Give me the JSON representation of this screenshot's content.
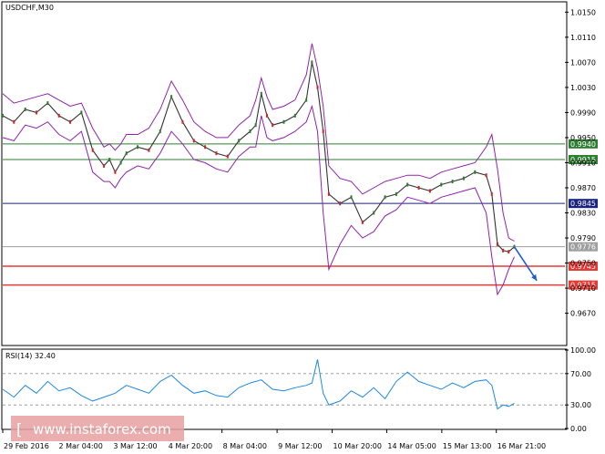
{
  "chart_data": [
    {
      "type": "line",
      "title": "USDCHF,M30",
      "indicator": "Bollinger Bands",
      "y_axis_side": "right",
      "ylim": [
        0.962,
        1.0165
      ],
      "x_range": [
        0,
        100
      ],
      "yticks": [
        "1.0150",
        "1.0110",
        "1.0070",
        "1.0030",
        "0.9990",
        "0.9950",
        "0.9910",
        "0.9870",
        "0.9830",
        "0.9790",
        "0.9750",
        "0.9710",
        "0.9670"
      ],
      "xticks": [
        {
          "x": 0,
          "label": "29 Feb 2016"
        },
        {
          "x": 9.8,
          "label": "2 Mar 04:00"
        },
        {
          "x": 19.5,
          "label": "3 Mar 12:00"
        },
        {
          "x": 29.3,
          "label": "4 Mar 20:00"
        },
        {
          "x": 39.0,
          "label": "8 Mar 04:00"
        },
        {
          "x": 48.8,
          "label": "9 Mar 12:00"
        },
        {
          "x": 58.6,
          "label": "10 Mar 20:00"
        },
        {
          "x": 68.3,
          "label": "14 Mar 05:00"
        },
        {
          "x": 78.1,
          "label": "15 Mar 13:00"
        },
        {
          "x": 87.8,
          "label": "16 Mar 21:00"
        }
      ],
      "levels": [
        {
          "value": 0.994,
          "label": "0.9940",
          "color": "#2e7d32",
          "label_bg": "#2e7d32"
        },
        {
          "value": 0.9915,
          "label": "0.9915",
          "color": "#2e7d32",
          "label_bg": "#2e7d32"
        },
        {
          "value": 0.9845,
          "label": "0.9845",
          "color": "#1a237e",
          "label_bg": "#1a237e"
        },
        {
          "value": 0.9776,
          "label": "0.9776",
          "color": "#9e9e9e",
          "label_bg": "#9e9e9e"
        },
        {
          "value": 0.9745,
          "label": "0.9745",
          "color": "#e53935",
          "label_bg": "#e53935"
        },
        {
          "value": 0.9715,
          "label": "0.9715",
          "color": "#e53935",
          "label_bg": "#e53935"
        }
      ],
      "price": {
        "x": [
          0,
          2,
          4,
          6,
          8,
          10,
          12,
          14,
          16,
          18,
          19,
          20,
          21,
          22,
          24,
          26,
          28,
          30,
          32,
          34,
          36,
          38,
          40,
          42,
          44,
          45,
          46,
          47,
          48,
          50,
          52,
          54,
          55,
          56,
          57,
          58,
          60,
          62,
          64,
          66,
          68,
          70,
          72,
          74,
          76,
          78,
          80,
          82,
          84,
          86,
          87,
          88,
          89,
          90,
          91
        ],
        "y": [
          0.9985,
          0.9975,
          0.9995,
          0.999,
          1.0005,
          0.9985,
          0.9975,
          0.999,
          0.993,
          0.9905,
          0.9915,
          0.9895,
          0.991,
          0.9925,
          0.9935,
          0.993,
          0.996,
          1.0015,
          0.9975,
          0.9945,
          0.9935,
          0.9925,
          0.992,
          0.9945,
          0.996,
          0.997,
          1.002,
          0.9985,
          0.997,
          0.9975,
          0.9985,
          1.001,
          1.007,
          1.003,
          0.996,
          0.986,
          0.9845,
          0.9855,
          0.9815,
          0.983,
          0.9855,
          0.986,
          0.9875,
          0.987,
          0.9865,
          0.9875,
          0.988,
          0.9885,
          0.9895,
          0.989,
          0.986,
          0.978,
          0.977,
          0.9768,
          0.9776
        ],
        "upper": [
          1.002,
          1.0005,
          1.001,
          1.0015,
          1.002,
          1.001,
          1.0,
          1.0005,
          0.9965,
          0.9935,
          0.994,
          0.993,
          0.994,
          0.9955,
          0.9955,
          0.9965,
          0.9995,
          1.004,
          1.001,
          0.9975,
          0.996,
          0.995,
          0.995,
          0.997,
          0.9985,
          1.001,
          1.0045,
          1.0015,
          0.9995,
          1.0,
          1.001,
          1.005,
          1.01,
          1.006,
          1.0,
          0.9905,
          0.9885,
          0.988,
          0.986,
          0.987,
          0.988,
          0.9885,
          0.989,
          0.989,
          0.9885,
          0.9895,
          0.99,
          0.9905,
          0.991,
          0.9935,
          0.9955,
          0.99,
          0.983,
          0.979,
          0.9785
        ],
        "lower": [
          0.995,
          0.9945,
          0.997,
          0.9965,
          0.9975,
          0.9955,
          0.9945,
          0.996,
          0.9895,
          0.988,
          0.988,
          0.987,
          0.9885,
          0.9895,
          0.9905,
          0.99,
          0.9925,
          0.996,
          0.994,
          0.9915,
          0.991,
          0.99,
          0.9895,
          0.992,
          0.9935,
          0.9935,
          0.9985,
          0.995,
          0.9945,
          0.995,
          0.996,
          0.9975,
          1.0,
          0.996,
          0.983,
          0.974,
          0.978,
          0.981,
          0.979,
          0.98,
          0.9825,
          0.9835,
          0.9855,
          0.985,
          0.9845,
          0.9855,
          0.986,
          0.9865,
          0.987,
          0.983,
          0.976,
          0.97,
          0.9715,
          0.974,
          0.976
        ]
      },
      "forecast_arrow": {
        "from": {
          "x": 91,
          "y": 0.9776
        },
        "to": {
          "x": 95,
          "y": 0.9722
        },
        "color": "#1e5bd6"
      }
    },
    {
      "type": "line",
      "title": "RSI(14) 32.40",
      "ylim": [
        0,
        100
      ],
      "yticks": [
        "100.00",
        "70.00",
        "30.00",
        "0.00"
      ],
      "levels": [
        70,
        30
      ],
      "series": [
        {
          "x": [
            0,
            2,
            4,
            6,
            8,
            10,
            12,
            14,
            16,
            18,
            20,
            22,
            24,
            26,
            28,
            30,
            32,
            34,
            36,
            38,
            40,
            42,
            44,
            46,
            48,
            50,
            52,
            54,
            55,
            56,
            57,
            58,
            60,
            62,
            64,
            66,
            68,
            70,
            72,
            74,
            76,
            78,
            80,
            82,
            84,
            86,
            87,
            88,
            89,
            90,
            91
          ],
          "y": [
            50,
            40,
            55,
            45,
            60,
            48,
            52,
            42,
            35,
            40,
            45,
            55,
            50,
            45,
            60,
            68,
            55,
            45,
            48,
            42,
            40,
            52,
            58,
            62,
            50,
            48,
            52,
            55,
            58,
            88,
            45,
            30,
            35,
            48,
            40,
            52,
            38,
            60,
            72,
            60,
            55,
            50,
            58,
            52,
            60,
            62,
            55,
            25,
            30,
            28,
            32
          ]
        }
      ]
    }
  ],
  "watermark": "www.instaforex.com",
  "watermark_bracket": "["
}
